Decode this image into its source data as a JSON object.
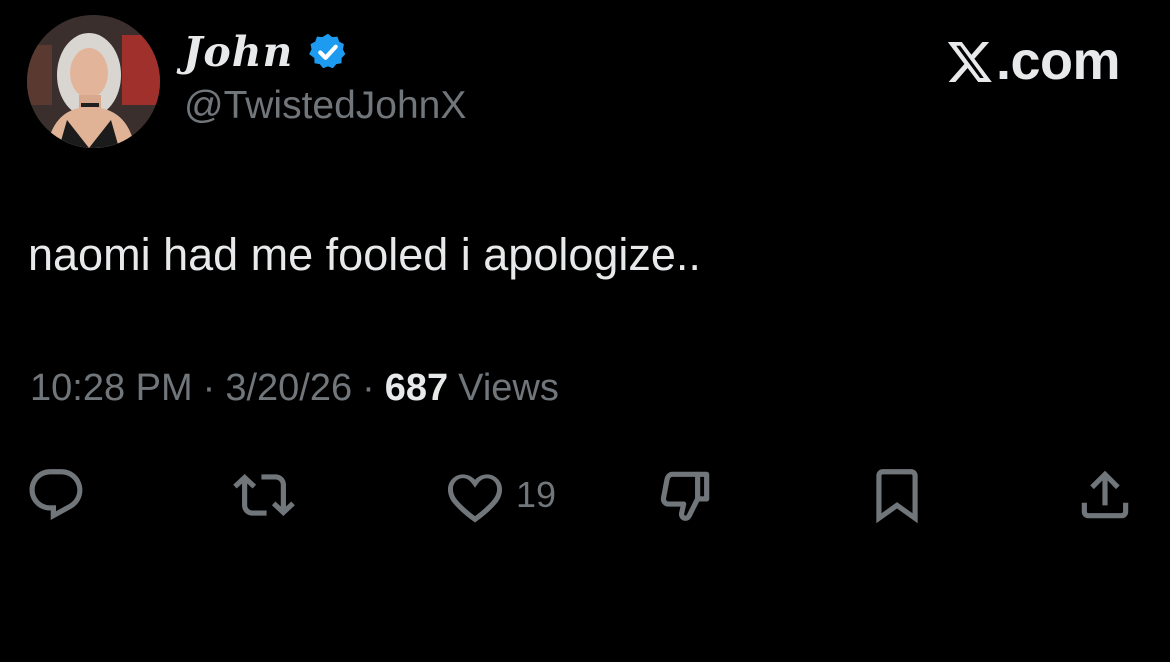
{
  "author": {
    "display_name": "John",
    "handle": "@TwistedJohnX",
    "verified": true,
    "avatar_icon": "user-avatar-photo"
  },
  "brand": {
    "text": ".com",
    "logo_icon": "x-logo-icon"
  },
  "tweet": {
    "text": "naomi had me fooled i apologize.."
  },
  "meta": {
    "time": "10:28 PM",
    "date": "3/20/26",
    "separator": "·",
    "views_count": "687",
    "views_label": "Views"
  },
  "actions": {
    "reply_icon": "reply-icon",
    "repost_icon": "repost-icon",
    "like_icon": "heart-icon",
    "like_count": "19",
    "dislike_icon": "thumbs-down-icon",
    "bookmark_icon": "bookmark-icon",
    "share_icon": "share-icon"
  },
  "colors": {
    "background": "#000000",
    "primary_text": "#e7e9ea",
    "secondary_text": "#71767b",
    "verified_badge": "#1d9bf0"
  }
}
